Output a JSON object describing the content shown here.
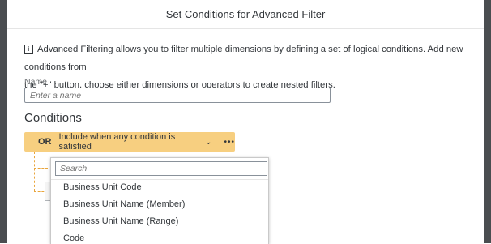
{
  "dialog": {
    "title": "Set Conditions for Advanced Filter",
    "info_icon": "info-icon",
    "info_line1": "Advanced Filtering allows you to filter multiple dimensions by defining a set of logical conditions. Add new conditions from",
    "info_line2": "the \"+\" button, choose either dimensions or operators to create nested filters."
  },
  "name_field": {
    "label": "Name",
    "placeholder": "Enter a name",
    "value": ""
  },
  "conditions": {
    "title": "Conditions",
    "operator": "OR",
    "operator_description": "Include when any condition is satisfied",
    "chevron_icon": "chevron-down-icon",
    "more_icon": "more-icon",
    "accent_color": "#f7cf80"
  },
  "dropdown": {
    "search_placeholder": "Search",
    "options": [
      "Business Unit Code",
      "Business Unit Name (Member)",
      "Business Unit Name (Range)",
      "Code"
    ]
  }
}
